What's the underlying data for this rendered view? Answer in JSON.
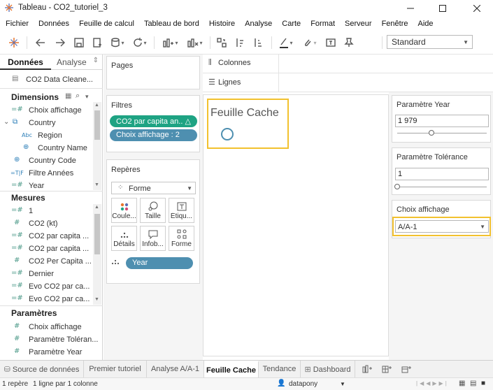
{
  "window": {
    "title": "Tableau - CO2_tutoriel_3"
  },
  "menu": [
    "Fichier",
    "Données",
    "Feuille de calcul",
    "Tableau de bord",
    "Histoire",
    "Analyse",
    "Carte",
    "Format",
    "Serveur",
    "Fenêtre",
    "Aide"
  ],
  "toolbar": {
    "fit_select": "Standard"
  },
  "left_pane": {
    "tabs": [
      "Données",
      "Analyse"
    ],
    "datasource": "CO2 Data Cleane...",
    "dimensions_label": "Dimensions",
    "dimensions": [
      {
        "name": "Choix affichage",
        "icon": "=#"
      },
      {
        "name": "Country",
        "icon": "hierarchy"
      },
      {
        "name": "Region",
        "icon": "Abc"
      },
      {
        "name": "Country Name",
        "icon": "globe"
      },
      {
        "name": "Country Code",
        "icon": "globe"
      },
      {
        "name": "Filtre Années",
        "icon": "=T|F"
      },
      {
        "name": "Year",
        "icon": "=#"
      }
    ],
    "measures_label": "Mesures",
    "measures": [
      {
        "name": "1",
        "icon": "=#"
      },
      {
        "name": "CO2 (kt)",
        "icon": "#"
      },
      {
        "name": "CO2 par capita ...",
        "icon": "=#"
      },
      {
        "name": "CO2 par capita ...",
        "icon": "=#"
      },
      {
        "name": "CO2 Per Capita ...",
        "icon": "#"
      },
      {
        "name": "Dernier",
        "icon": "=#"
      },
      {
        "name": "Evo CO2 par ca...",
        "icon": "=#"
      },
      {
        "name": "Evo CO2 par ca...",
        "icon": "=#"
      }
    ],
    "parameters_label": "Paramètres",
    "parameters": [
      {
        "name": "Choix affichage",
        "icon": "#"
      },
      {
        "name": "Paramètre Toléran...",
        "icon": "#"
      },
      {
        "name": "Paramètre Year",
        "icon": "#"
      }
    ]
  },
  "cards": {
    "pages_label": "Pages",
    "filters_label": "Filtres",
    "filters": [
      "CO2 par capita an.. △",
      "Choix affichage : 2"
    ],
    "marks_label": "Repères",
    "mark_type": "Forme",
    "mark_buttons": [
      "Coule...",
      "Taille",
      "Étiqu...",
      "Détails",
      "Infob...",
      "Forme"
    ],
    "mark_pill": "Year"
  },
  "shelves": {
    "columns_label": "Colonnes",
    "rows_label": "Lignes"
  },
  "view": {
    "sheet_title": "Feuille Cache"
  },
  "params": {
    "year": {
      "title": "Paramètre Year",
      "value": "1 979",
      "slider_fraction": 0.38
    },
    "tolerance": {
      "title": "Paramètre Tolérance",
      "value": "1",
      "slider_fraction": 0.0
    },
    "choix": {
      "title": "Choix affichage",
      "value": "A/A-1"
    }
  },
  "sheet_tabs": [
    "Source de données",
    "Premier tutoriel",
    "Analyse A/A-1",
    "Feuille Cache",
    "Tendance",
    "Dashboard"
  ],
  "active_tab": "Feuille Cache",
  "status": {
    "marks": "1 repère",
    "rows_cols": "1 ligne par 1 colonne",
    "user": "datapony"
  },
  "colors": {
    "green_pill": "#1ea383",
    "blue_pill": "#4e8fb0",
    "highlight": "#f2c12e",
    "accent": "#e8762d"
  }
}
